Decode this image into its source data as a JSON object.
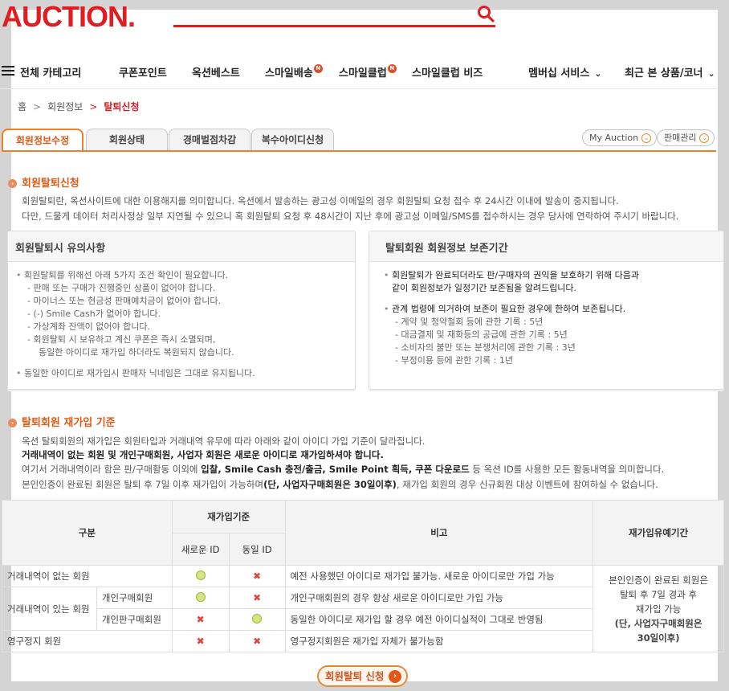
{
  "brand": {
    "logo": "AUCTION."
  },
  "nav": {
    "category": "전체 카테고리",
    "items": [
      "쿠폰포인트",
      "옥션베스트",
      "스마일배송",
      "스마일클럽",
      "스마일클럽 비즈"
    ],
    "badge": "N",
    "membership": "멤버십 서비스",
    "recent": "최근 본 상품/코너"
  },
  "breadcrumb": {
    "home": "홈",
    "level1": "회원정보",
    "current": "탈퇴신청"
  },
  "tabs": [
    "회원정보수정",
    "회원상태",
    "경매벌점차감",
    "복수아이디신청"
  ],
  "utility": {
    "my_auction": "My Auction",
    "seller_admin": "판매관리"
  },
  "section1": {
    "title": "회원탈퇴신청",
    "lines": [
      "회원탈퇴란, 옥션사이트에 대한 이용해지를 의미합니다. 옥션에서 발송하는 광고성 이메일의 경우 회원탈퇴 요청 접수 후 24시간 이내에 발송이 중지됩니다.",
      "다만, 드물게 데이터 처리사정상 일부 지연될 수 있으니 혹 회원탈퇴 요청 후 48시간이 지난 후에 광고성 이메일/SMS를 접수하시는 경우 당사에 연락하여 주시기 바랍니다."
    ]
  },
  "box_left": {
    "title": "회원탈퇴시 유의사항",
    "lead": "회원탈퇴를 위해선 아래 5가지 조건 확인이 필요합니다.",
    "conditions": [
      "- 판매 또는 구매가 진행중인 상품이 없어야 합니다.",
      "- 마이너스 또는 현금성 판매예치금이 없어야 합니다.",
      "- (-) Smile Cash가 없어야 합니다.",
      "- 가상계좌 잔액이 없어야 합니다.",
      "- 회원탈퇴 시 보유하고 계신 쿠폰은 즉시 소멸되며,",
      "동일한 아이디로 재가입 하더라도 복원되지 않습니다."
    ],
    "note": "동일한 아이디로 재가입시 판매자 닉네임은 그대로 유지됩니다."
  },
  "box_right": {
    "title": "탈퇴회원 회원정보 보존기간",
    "lead1": "회원탈퇴가 완료되더라도 판/구매자의 권익을 보호하기 위해 다음과",
    "lead2": "같이 회원정보가 일정기간 보존됨을 알려드립니다.",
    "law": "관계 법령에 의거하여 보존이 필요한 경우에 한하여 보존됩니다.",
    "records": [
      "- 계약 및 청약철회 등에 관한 기록 : 5년",
      "- 대금결제 및 재화등의 공급에 관한 기록 : 5년",
      "- 소비자의 불만 또는 분쟁처리에 관한 기록 : 3년",
      "- 부정이용 등에 관한 기록 : 1년"
    ]
  },
  "section2": {
    "title": "탈퇴회원 재가입 기준",
    "line1": "옥션 탈퇴회원의 재가입은 회원타입과 거래내역 유무에 따라 아래와 같이 아이디 가입 기준이 달라집니다.",
    "line2": "거래내역이 없는 회원 및 개인구매회원, 사업자 회원은 새로운 아이디로 재가입하셔야 합니다.",
    "line3_a": "여기서 거래내역이라 함은 판/구매활동 이외에 ",
    "line3_b": "입찰, Smile Cash 충전/출금, Smile Point 획득, 쿠폰 다운로드",
    "line3_c": " 등 옥션 ID를 사용한 모든 활동내역을 의미합니다.",
    "line4_a": "본인인증이 완료된 회원은 탈퇴 후 7일 이후 재가입이 가능하며",
    "line4_b": "(단, 사업자구매회원은 30일이후)",
    "line4_c": ", 재가입 회원의 경우 신규회원 대상 이벤트에 참여하실 수 없습니다."
  },
  "table": {
    "h_type": "구분",
    "h_criteria": "재가입기준",
    "h_new": "새로운 ID",
    "h_same": "동일 ID",
    "h_note": "비고",
    "h_grace": "재가입유예기간",
    "rows": [
      {
        "type": "거래내역이 없는 회원",
        "new": "ok",
        "same": "no",
        "note": "예전 사용했던 아이디로 재가입 불가능. 새로운 아이디로만 가입 가능"
      },
      {
        "type": "거래내역이 있는 회원",
        "sub": "개인구매회원",
        "new": "ok",
        "same": "no",
        "note": "개인구매회원의 경우 항상 새로운 아이디로만 가입 가능"
      },
      {
        "sub": "개인판구매회원",
        "new": "no",
        "same": "ok",
        "note": "동일한 아이디로 재가입 할 경우 예전 아이디실적이 그대로 반영됨"
      },
      {
        "type": "영구정지 회원",
        "new": "no",
        "same": "no",
        "note": "영구정지회원은 재가입 자체가 불가능함"
      }
    ],
    "grace_1": "본인인증이 완료된 회원은",
    "grace_2": "탈퇴 후 7일 경과 후",
    "grace_3": "재가입 가능",
    "grace_4": "(단, 사업자구매회원은",
    "grace_5": "30일이후)"
  },
  "button": {
    "label": "회원탈퇴 신청"
  }
}
